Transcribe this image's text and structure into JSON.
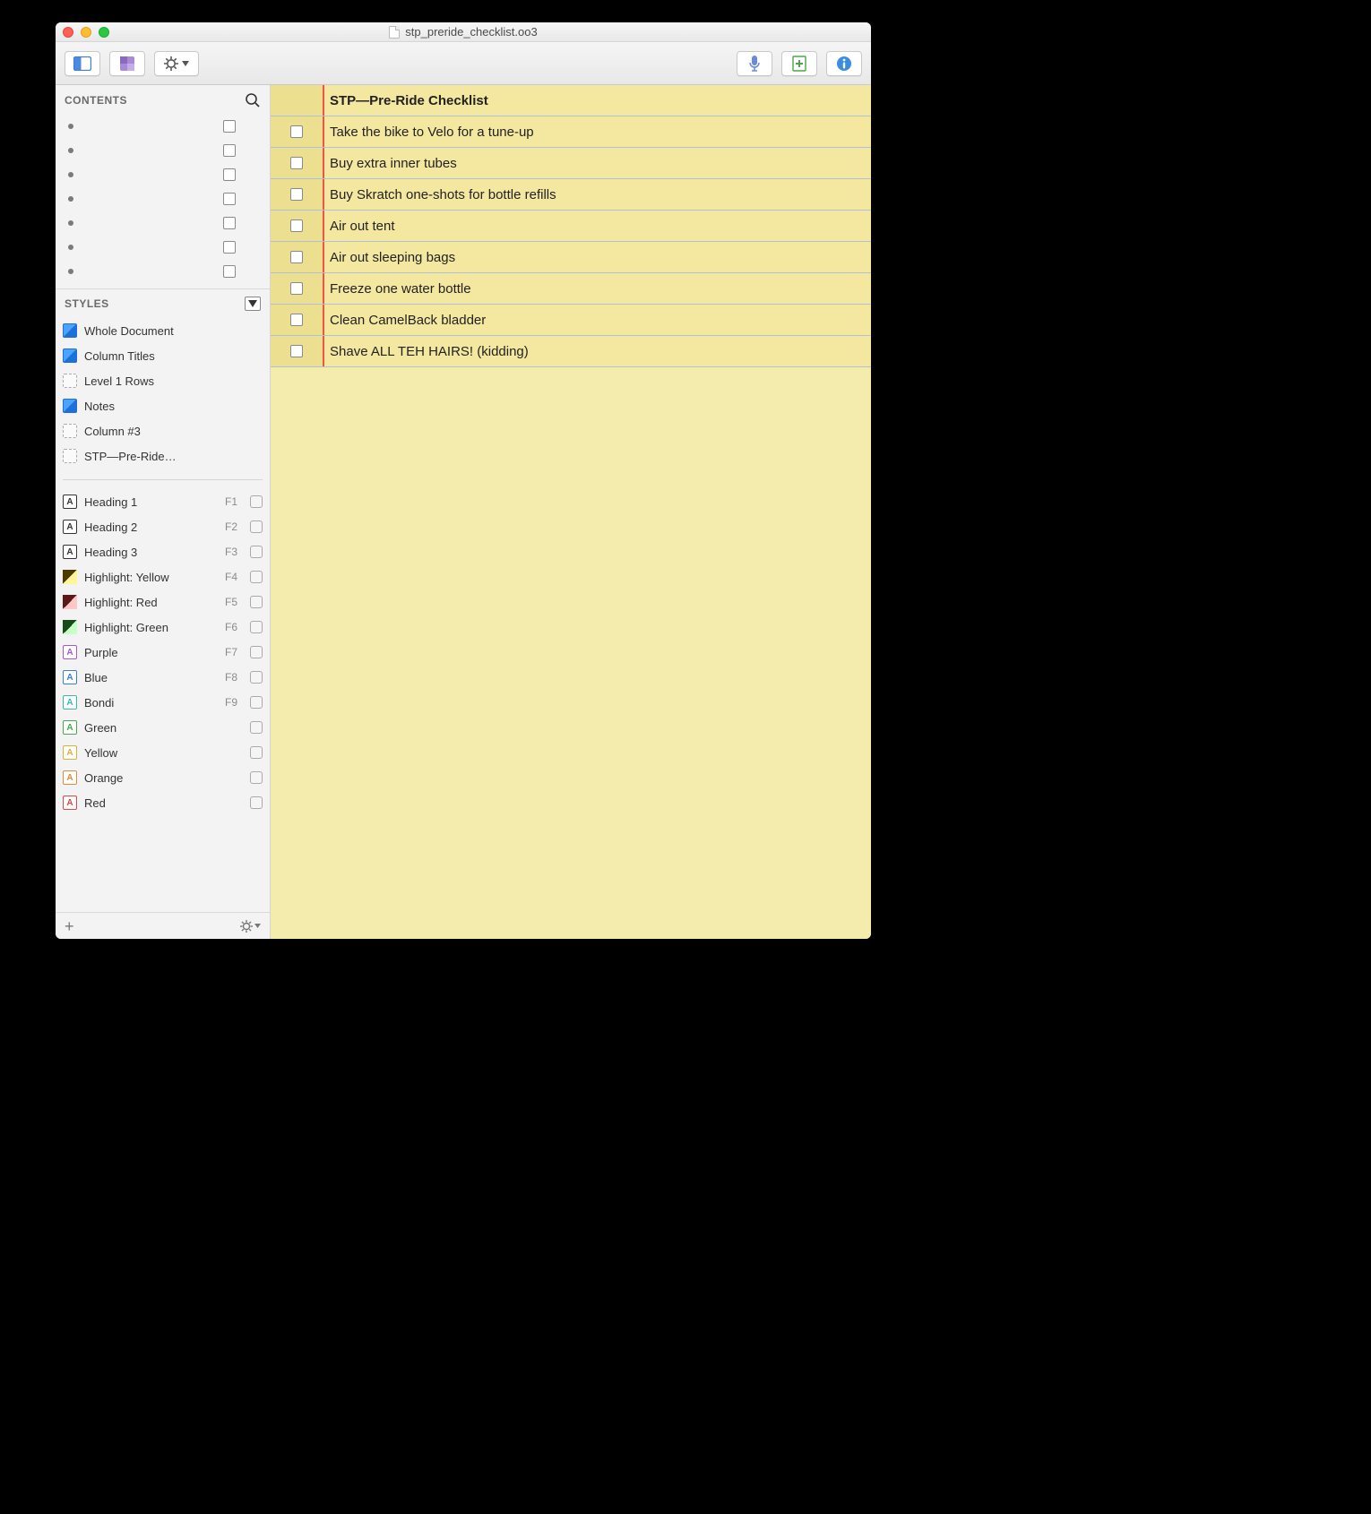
{
  "window": {
    "title": "stp_preride_checklist.oo3"
  },
  "sidebar": {
    "contents_label": "CONTENTS",
    "styles_label": "STYLES",
    "doc_styles": [
      {
        "label": "Whole Document",
        "icon": "blue"
      },
      {
        "label": "Column Titles",
        "icon": "blue"
      },
      {
        "label": "Level 1 Rows",
        "icon": "dashed"
      },
      {
        "label": "Notes",
        "icon": "blue"
      },
      {
        "label": "Column #3",
        "icon": "dashed"
      },
      {
        "label": "STP—Pre-Ride…",
        "icon": "dashed"
      }
    ],
    "named_styles": [
      {
        "label": "Heading 1",
        "fk": "F1",
        "icon": "A",
        "color": "#333"
      },
      {
        "label": "Heading 2",
        "fk": "F2",
        "icon": "A",
        "color": "#333"
      },
      {
        "label": "Heading 3",
        "fk": "F3",
        "icon": "A",
        "color": "#333"
      },
      {
        "label": "Highlight: Yellow",
        "fk": "F4",
        "icon": "hiY"
      },
      {
        "label": "Highlight: Red",
        "fk": "F5",
        "icon": "hiR"
      },
      {
        "label": "Highlight: Green",
        "fk": "F6",
        "icon": "hiG"
      },
      {
        "label": "Purple",
        "fk": "F7",
        "icon": "A",
        "color": "#a05ad6"
      },
      {
        "label": "Blue",
        "fk": "F8",
        "icon": "A",
        "color": "#3a7de0"
      },
      {
        "label": "Bondi",
        "fk": "F9",
        "icon": "A",
        "color": "#3ab8b0"
      },
      {
        "label": "Green",
        "fk": "",
        "icon": "A",
        "color": "#4aa64a"
      },
      {
        "label": "Yellow",
        "fk": "",
        "icon": "A",
        "color": "#d6b43a"
      },
      {
        "label": "Orange",
        "fk": "",
        "icon": "A",
        "color": "#e08a3a"
      },
      {
        "label": "Red",
        "fk": "",
        "icon": "A",
        "color": "#d64a4a"
      }
    ]
  },
  "outline": {
    "header": "STP—Pre-Ride Checklist",
    "rows": [
      "Take the bike to Velo for a tune-up",
      "Buy extra inner tubes",
      "Buy Skratch one-shots for bottle refills",
      "Air out tent",
      "Air out sleeping bags",
      "Freeze one water bottle",
      "Clean CamelBack bladder",
      "Shave ALL TEH HAIRS! (kidding)"
    ]
  }
}
